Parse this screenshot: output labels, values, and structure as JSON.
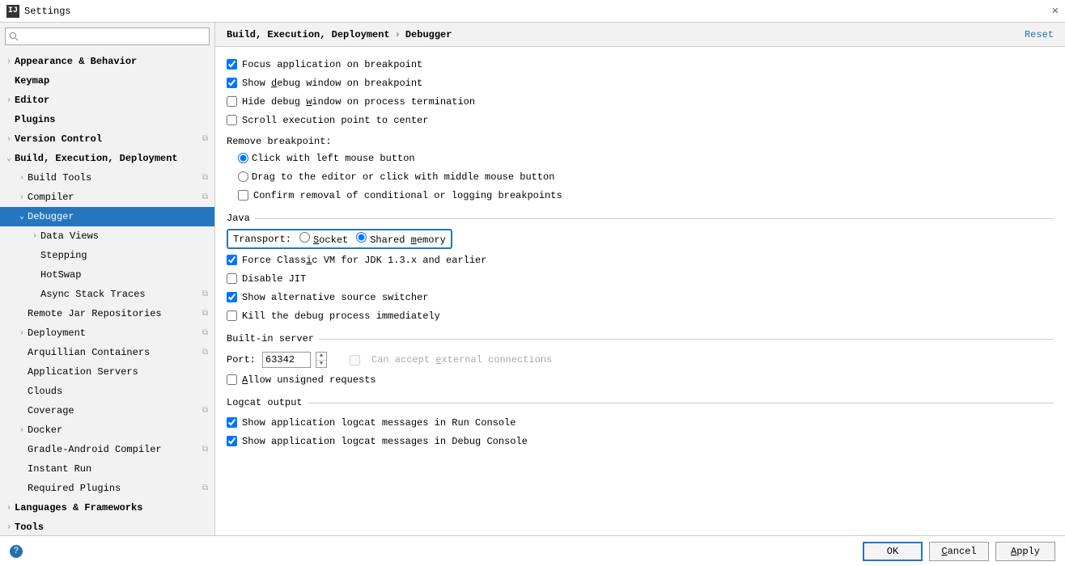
{
  "window": {
    "title": "Settings",
    "search_placeholder": ""
  },
  "sidebar": {
    "items": [
      {
        "label": "Appearance & Behavior",
        "indent": 0,
        "chev": "right",
        "bold": true
      },
      {
        "label": "Keymap",
        "indent": 0,
        "chev": "",
        "bold": true
      },
      {
        "label": "Editor",
        "indent": 0,
        "chev": "right",
        "bold": true
      },
      {
        "label": "Plugins",
        "indent": 0,
        "chev": "",
        "bold": true
      },
      {
        "label": "Version Control",
        "indent": 0,
        "chev": "right",
        "bold": true,
        "proj": true
      },
      {
        "label": "Build, Execution, Deployment",
        "indent": 0,
        "chev": "down",
        "bold": true
      },
      {
        "label": "Build Tools",
        "indent": 1,
        "chev": "right",
        "proj": true
      },
      {
        "label": "Compiler",
        "indent": 1,
        "chev": "right",
        "proj": true
      },
      {
        "label": "Debugger",
        "indent": 1,
        "chev": "down",
        "selected": true
      },
      {
        "label": "Data Views",
        "indent": 2,
        "chev": "right"
      },
      {
        "label": "Stepping",
        "indent": 2,
        "chev": ""
      },
      {
        "label": "HotSwap",
        "indent": 2,
        "chev": ""
      },
      {
        "label": "Async Stack Traces",
        "indent": 2,
        "chev": "",
        "proj": true
      },
      {
        "label": "Remote Jar Repositories",
        "indent": 1,
        "chev": "",
        "proj": true
      },
      {
        "label": "Deployment",
        "indent": 1,
        "chev": "right",
        "proj": true
      },
      {
        "label": "Arquillian Containers",
        "indent": 1,
        "chev": "",
        "proj": true
      },
      {
        "label": "Application Servers",
        "indent": 1,
        "chev": ""
      },
      {
        "label": "Clouds",
        "indent": 1,
        "chev": ""
      },
      {
        "label": "Coverage",
        "indent": 1,
        "chev": "",
        "proj": true
      },
      {
        "label": "Docker",
        "indent": 1,
        "chev": "right"
      },
      {
        "label": "Gradle-Android Compiler",
        "indent": 1,
        "chev": "",
        "proj": true
      },
      {
        "label": "Instant Run",
        "indent": 1,
        "chev": ""
      },
      {
        "label": "Required Plugins",
        "indent": 1,
        "chev": "",
        "proj": true
      },
      {
        "label": "Languages & Frameworks",
        "indent": 0,
        "chev": "right",
        "bold": true
      },
      {
        "label": "Tools",
        "indent": 0,
        "chev": "right",
        "bold": true
      }
    ]
  },
  "breadcrumb": {
    "a": "Build, Execution, Deployment",
    "b": "Debugger",
    "reset": "Reset"
  },
  "opts": {
    "focus_app": "Focus application on breakpoint",
    "show_debug_pre": "Show ",
    "show_debug_u": "d",
    "show_debug_post": "ebug window on breakpoint",
    "hide_debug_pre": "Hide debug ",
    "hide_debug_u": "w",
    "hide_debug_post": "indow on process termination",
    "scroll_exec": "Scroll execution point to center",
    "remove_bp": "Remove breakpoint:",
    "click_left": "Click with left mouse button",
    "drag_middle": "Drag to the editor or click with middle mouse button",
    "confirm_removal": "Confirm removal of conditional or logging breakpoints"
  },
  "java": {
    "legend": "Java",
    "transport_label": "Transport:",
    "socket_u": "S",
    "socket_post": "ocket",
    "shared_pre": "Shared ",
    "shared_u": "m",
    "shared_post": "emory",
    "force_pre": "Force Class",
    "force_u": "i",
    "force_post": "c VM for JDK 1.3.x and earlier",
    "disable_jit": "Disable JIT",
    "show_alt": "Show alternative source switcher",
    "kill": "Kill the debug process immediately"
  },
  "server": {
    "legend": "Built-in server",
    "port_label": "Port:",
    "port_value": "63342",
    "can_accept_pre": "Can accept ",
    "can_accept_u": "e",
    "can_accept_post": "xternal connections",
    "allow_u": "A",
    "allow_post": "llow unsigned requests"
  },
  "logcat": {
    "legend": "Logcat output",
    "run": "Show application logcat messages in Run Console",
    "debug": "Show application logcat messages in Debug Console"
  },
  "buttons": {
    "ok": "OK",
    "cancel_u": "C",
    "cancel_post": "ancel",
    "apply_u": "A",
    "apply_post": "pply"
  }
}
